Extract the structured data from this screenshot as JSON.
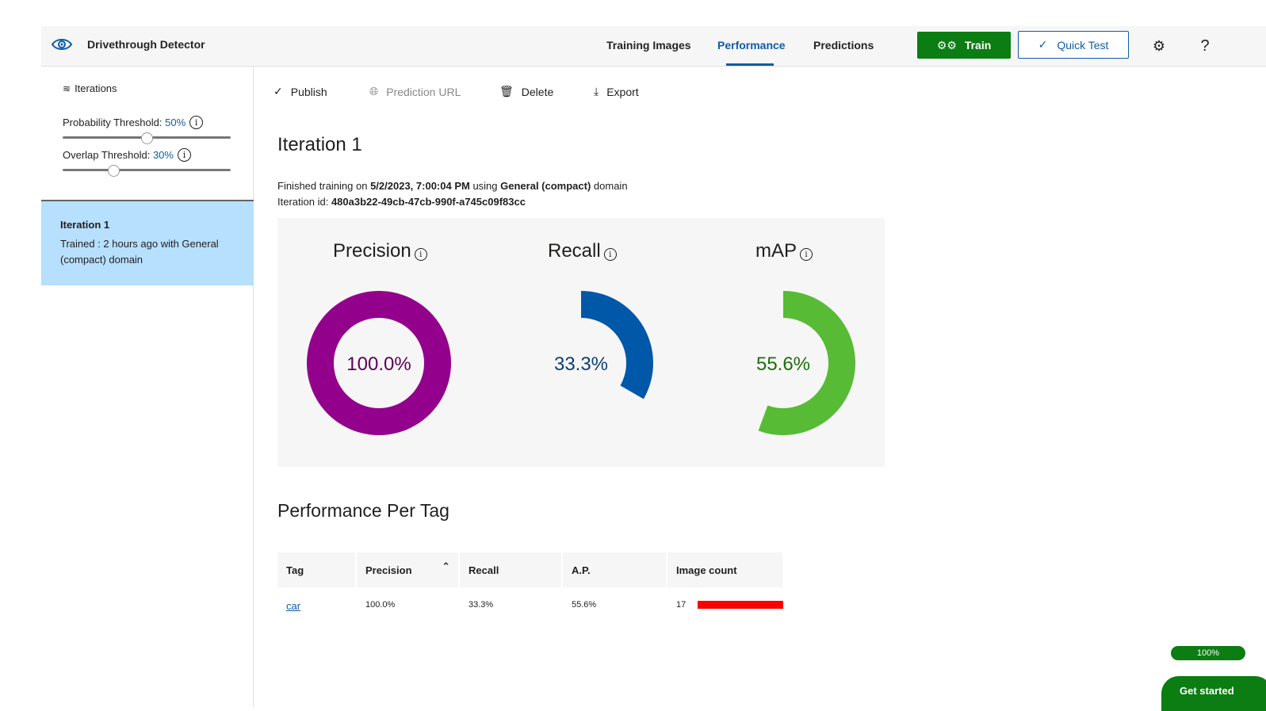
{
  "header": {
    "app_title": "Drivethrough Detector",
    "tabs": [
      {
        "label": "Training Images",
        "active": false
      },
      {
        "label": "Performance",
        "active": true
      },
      {
        "label": "Predictions",
        "active": false
      }
    ],
    "train_label": "Train",
    "quick_test_label": "Quick Test",
    "help_label": "?",
    "icons": {
      "brand": "eye-gear-icon",
      "train": "gears-icon",
      "quick_test": "check-icon",
      "settings": "gear-icon",
      "help": "question-icon"
    }
  },
  "sidebar": {
    "iterations_label": "Iterations",
    "probability_threshold": {
      "label": "Probability Threshold:",
      "value_text": "50%",
      "value": 0.5
    },
    "overlap_threshold": {
      "label": "Overlap Threshold:",
      "value_text": "30%",
      "value": 0.3
    },
    "iterations": [
      {
        "title": "Iteration 1",
        "description": "Trained : 2 hours ago with General (compact) domain",
        "selected": true
      }
    ]
  },
  "toolbar": {
    "publish_label": "Publish",
    "prediction_url_label": "Prediction URL",
    "delete_label": "Delete",
    "export_label": "Export"
  },
  "iteration": {
    "title": "Iteration 1",
    "finished_prefix": "Finished training on ",
    "finished_date": "5/2/2023, 7:00:04 PM",
    "using_text": " using ",
    "domain_name": "General (compact)",
    "domain_suffix": " domain",
    "id_label": "Iteration id: ",
    "id_value": "480a3b22-49cb-47cb-990f-a745c09f83cc"
  },
  "metrics": [
    {
      "name": "Precision",
      "value": 100.0,
      "label": "100.0%",
      "color": "#93008c",
      "text_color": "#5b0057"
    },
    {
      "name": "Recall",
      "value": 33.3,
      "label": "33.3%",
      "color": "#0157a8",
      "text_color": "#0c3e74"
    },
    {
      "name": "mAP",
      "value": 55.6,
      "label": "55.6%",
      "color": "#57bb36",
      "text_color": "#1d6e0a"
    }
  ],
  "per_tag": {
    "title": "Performance Per Tag",
    "columns": [
      "Tag",
      "Precision",
      "Recall",
      "A.P.",
      "Image count"
    ],
    "sort_indicator": "^",
    "rows": [
      {
        "tag": "car",
        "precision": "100.0%",
        "recall": "33.3%",
        "ap": "55.6%",
        "image_count": "17"
      }
    ],
    "bar_color": "#fc0000"
  },
  "footer": {
    "progress_label": "100%",
    "get_started_label": "Get started"
  }
}
